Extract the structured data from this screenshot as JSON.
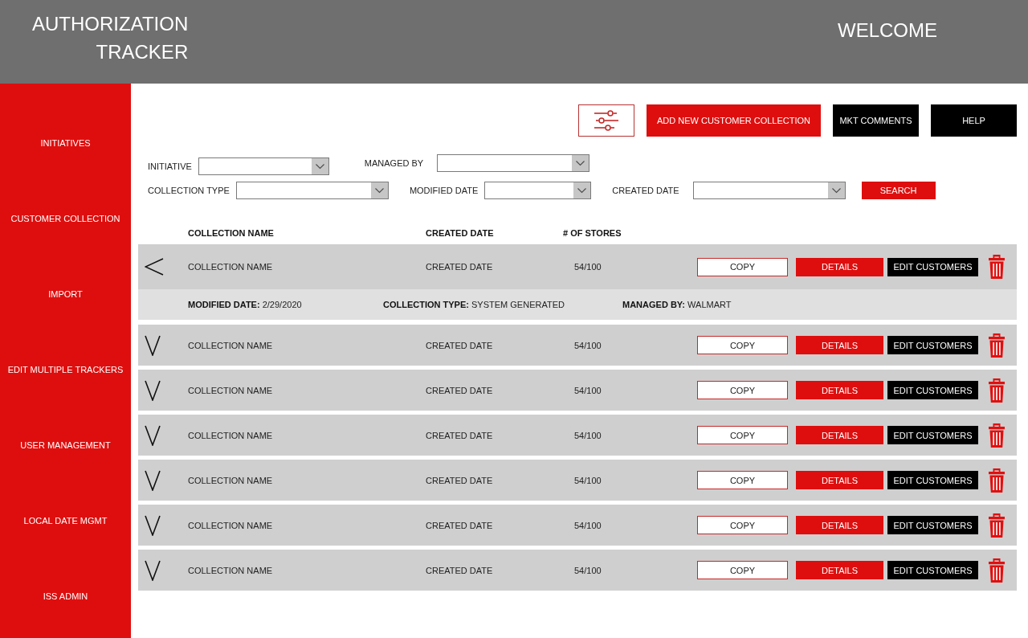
{
  "header": {
    "title": "AUTHORIZATION TRACKER",
    "greeting": "WELCOME"
  },
  "sidebar": {
    "items": [
      {
        "label": "INITIATIVES",
        "selected": false
      },
      {
        "label": "CUSTOMER COLLECTION",
        "selected": false
      },
      {
        "label": "IMPORT",
        "selected": false
      },
      {
        "label": "EDIT MULTIPLE TRACKERS",
        "selected": false
      },
      {
        "label": "USER MANAGEMENT",
        "selected": false
      },
      {
        "label": "LOCAL DATE MGMT",
        "selected": false
      },
      {
        "label": "ISS ADMIN",
        "selected": false
      }
    ]
  },
  "toolbar": {
    "buttons": [
      {
        "kind": "filter"
      },
      {
        "kind": "primary",
        "label": "ADD NEW CUSTOMER COLLECTION"
      },
      {
        "kind": "dark",
        "label": "MKT COMMENTS"
      },
      {
        "kind": "dark",
        "label": "HELP"
      }
    ]
  },
  "filters": {
    "rows": [
      [
        {
          "label": "INITIATIVE"
        },
        {
          "label": "MANAGED BY"
        }
      ],
      [
        {
          "label": "COLLECTION TYPE"
        },
        {
          "label": "MODIFIED DATE"
        },
        {
          "label": "CREATED DATE"
        }
      ]
    ],
    "search_button": "SEARCH"
  },
  "table": {
    "columns": [
      "COLLECTION NAME",
      "CREATED DATE",
      "# OF STORES"
    ],
    "rows": [
      {
        "expanded": true,
        "cells": [
          "COLLECTION NAME",
          "CREATED DATE",
          "54/100"
        ],
        "actions": [
          {
            "kind": "outline",
            "label": "COPY"
          },
          {
            "kind": "primary",
            "label": "DETAILS"
          },
          {
            "kind": "dark",
            "label": "EDIT CUSTOMERS"
          },
          {
            "kind": "delete"
          }
        ],
        "details": [
          "**MODIFIED DATE:** 2/29/2020",
          "**COLLECTION TYPE:** SYSTEM GENERATED",
          "**MANAGED BY:** WALMART"
        ]
      },
      {
        "expanded": false,
        "cells": [
          "COLLECTION NAME",
          "CREATED DATE",
          "54/100"
        ],
        "actions": [
          {
            "kind": "outline",
            "label": "COPY"
          },
          {
            "kind": "primary",
            "label": "DETAILS"
          },
          {
            "kind": "dark",
            "label": "EDIT CUSTOMERS"
          },
          {
            "kind": "delete"
          }
        ]
      },
      {
        "expanded": false,
        "cells": [
          "COLLECTION NAME",
          "CREATED DATE",
          "54/100"
        ],
        "actions": [
          {
            "kind": "outline",
            "label": "COPY"
          },
          {
            "kind": "primary",
            "label": "DETAILS"
          },
          {
            "kind": "dark",
            "label": "EDIT CUSTOMERS"
          },
          {
            "kind": "delete"
          }
        ]
      },
      {
        "expanded": false,
        "cells": [
          "COLLECTION NAME",
          "CREATED DATE",
          "54/100"
        ],
        "actions": [
          {
            "kind": "outline",
            "label": "COPY"
          },
          {
            "kind": "primary",
            "label": "DETAILS"
          },
          {
            "kind": "dark",
            "label": "EDIT CUSTOMERS"
          },
          {
            "kind": "delete"
          }
        ]
      },
      {
        "expanded": false,
        "cells": [
          "COLLECTION NAME",
          "CREATED DATE",
          "54/100"
        ],
        "actions": [
          {
            "kind": "outline",
            "label": "COPY"
          },
          {
            "kind": "primary",
            "label": "DETAILS"
          },
          {
            "kind": "dark",
            "label": "EDIT CUSTOMERS"
          },
          {
            "kind": "delete"
          }
        ]
      },
      {
        "expanded": false,
        "cells": [
          "COLLECTION NAME",
          "CREATED DATE",
          "54/100"
        ],
        "actions": [
          {
            "kind": "outline",
            "label": "COPY"
          },
          {
            "kind": "primary",
            "label": "DETAILS"
          },
          {
            "kind": "dark",
            "label": "EDIT CUSTOMERS"
          },
          {
            "kind": "delete"
          }
        ]
      },
      {
        "expanded": false,
        "cells": [
          "COLLECTION NAME",
          "CREATED DATE",
          "54/100"
        ],
        "actions": [
          {
            "kind": "outline",
            "label": "COPY"
          },
          {
            "kind": "primary",
            "label": "DETAILS"
          },
          {
            "kind": "dark",
            "label": "EDIT CUSTOMERS"
          },
          {
            "kind": "delete"
          }
        ]
      }
    ]
  }
}
